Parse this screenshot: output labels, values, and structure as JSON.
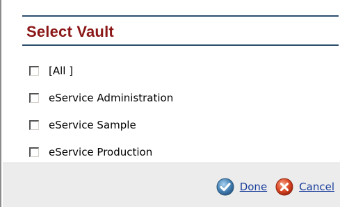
{
  "dialog": {
    "title": "Select Vault",
    "vaults": [
      {
        "label": "[All ]",
        "checked": false
      },
      {
        "label": "eService Administration",
        "checked": false
      },
      {
        "label": "eService Sample",
        "checked": false
      },
      {
        "label": "eService Production",
        "checked": false
      }
    ],
    "done_label": "Done",
    "cancel_label": "Cancel"
  },
  "icons": {
    "done": "check-circle-icon",
    "cancel": "x-circle-icon"
  },
  "colors": {
    "title": "#8b1616",
    "rule": "#2c4d6e",
    "link": "#1a3e9c",
    "footer_bg": "#ececec",
    "done_icon": "#4a86b8",
    "cancel_icon": "#c8381c"
  }
}
